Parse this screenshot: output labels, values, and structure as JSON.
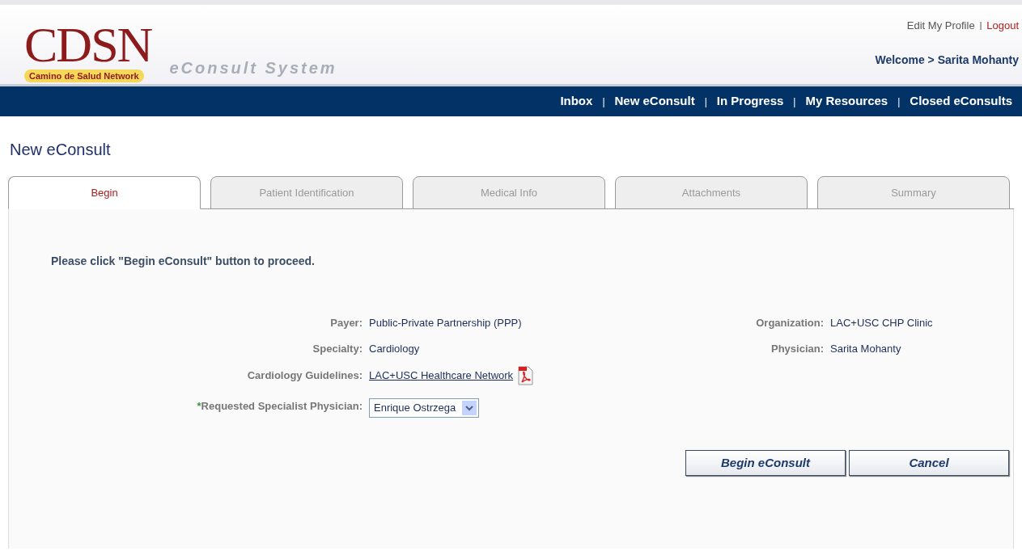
{
  "header": {
    "logo": {
      "letters": "CDSN",
      "tagline": "Camino de Salud Network"
    },
    "system_name": "eConsult System",
    "links": [
      {
        "label": "Edit My Profile",
        "kind": "plain"
      },
      {
        "label": "Logout",
        "kind": "alert"
      }
    ],
    "separator": "|",
    "welcome": "Welcome > Sarita Mohanty"
  },
  "nav": {
    "separator": "|",
    "items": [
      "Inbox",
      "New eConsult",
      "In Progress",
      "My Resources",
      "Closed eConsults"
    ]
  },
  "page_title": "New eConsult",
  "tabs": [
    {
      "label": "Begin",
      "selected": true
    },
    {
      "label": "Patient Identification",
      "selected": false
    },
    {
      "label": "Medical Info",
      "selected": false
    },
    {
      "label": "Attachments",
      "selected": false
    },
    {
      "label": "Summary",
      "selected": false
    }
  ],
  "instruction": "Please click \"Begin eConsult\" button to proceed.",
  "left_fields": [
    {
      "label": "Payer:",
      "value": "Public-Private Partnership (PPP)",
      "kind": "text"
    },
    {
      "label": "Specialty:",
      "value": "Cardiology",
      "kind": "text"
    },
    {
      "label": "Cardiology Guidelines:",
      "value": "LAC+USC Healthcare Network",
      "kind": "link"
    },
    {
      "label": "Requested Specialist Physician:",
      "value": "Enrique Ostrzega",
      "kind": "select",
      "required_mark": "*"
    }
  ],
  "right_fields": [
    {
      "label": "Organization:",
      "value": "LAC+USC CHP Clinic"
    },
    {
      "label": "Physician:",
      "value": "Sarita Mohanty"
    }
  ],
  "buttons": [
    "Begin eConsult",
    "Cancel"
  ]
}
